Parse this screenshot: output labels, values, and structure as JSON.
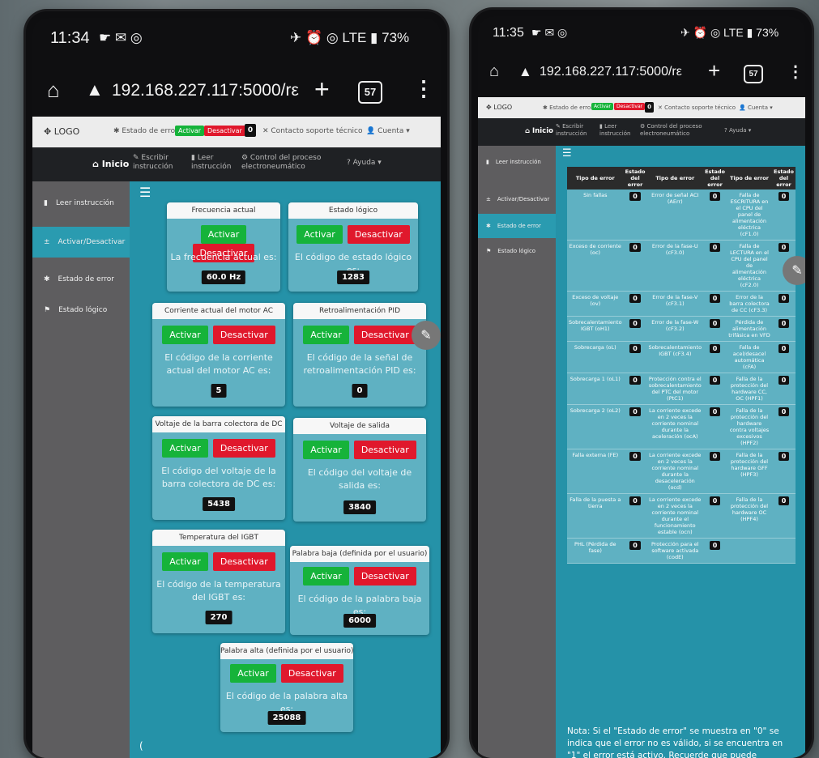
{
  "left_phone": {
    "status": {
      "time": "11:34",
      "icons": "☛ ✉ ◎",
      "right": "✈ ⏰ ◎ LTE ▮ 73%"
    },
    "urlbar": {
      "url": "192.168.227.117:5000/rε",
      "tabs": "57"
    },
    "topbar": {
      "logo": "✥ LOGO",
      "estado_error": "✱ Estado de error",
      "activar": "Activar",
      "desactivar": "Desactivar",
      "error_value": "0",
      "contacto": "✕ Contacto soporte técnico",
      "cuenta": "👤 Cuenta ▾"
    },
    "navbar": {
      "inicio": "⌂ Inicio",
      "escribir": "✎ Escribir instrucción",
      "leer": "▮ Leer instrucción",
      "control": "⚙ Control del proceso electroneumático",
      "ayuda": "? Ayuda ▾"
    },
    "sidebar": [
      {
        "label": "Leer instrucción",
        "icon": "▮"
      },
      {
        "label": "Activar/Desactivar",
        "icon": "±"
      },
      {
        "label": "Estado de error",
        "icon": "✱"
      },
      {
        "label": "Estado lógico",
        "icon": "⚑"
      }
    ],
    "menu_icon": "☰",
    "cards": [
      {
        "title": "Frecuencia actual",
        "activar": "Activar",
        "desactivar": "Desactivar",
        "desc": "La frecuencia actual es:",
        "value": "60.0 Hz"
      },
      {
        "title": "Estado lógico",
        "activar": "Activar",
        "desactivar": "Desactivar",
        "desc": "El código de estado lógico es:",
        "value": "1283"
      },
      {
        "title": "Corriente actual del motor AC",
        "activar": "Activar",
        "desactivar": "Desactivar",
        "desc": "El código de la corriente actual del motor AC es:",
        "value": "5"
      },
      {
        "title": "Retroalimentación PID",
        "activar": "Activar",
        "desactivar": "Desactivar",
        "desc": "El código de la señal de retroalimentación PID es:",
        "value": "0"
      },
      {
        "title": "Voltaje de la barra colectora de DC",
        "activar": "Activar",
        "desactivar": "Desactivar",
        "desc": "El código del voltaje de la barra colectora de DC es:",
        "value": "5438"
      },
      {
        "title": "Voltaje de salida",
        "activar": "Activar",
        "desactivar": "Desactivar",
        "desc": "El código del voltaje de salida es:",
        "value": "3840"
      },
      {
        "title": "Temperatura del IGBT",
        "activar": "Activar",
        "desactivar": "Desactivar",
        "desc": "El código de la temperatura del IGBT es:",
        "value": "270"
      },
      {
        "title": "Palabra baja (definida por el usuario)",
        "activar": "Activar",
        "desactivar": "Desactivar",
        "desc": "El código de la palabra baja es:",
        "value": "6000"
      },
      {
        "title": "Palabra alta (definida por el usuario)",
        "activar": "Activar",
        "desactivar": "Desactivar",
        "desc": "El código de la palabra alta es:",
        "value": "25088"
      }
    ],
    "footer_char": "("
  },
  "right_phone": {
    "status": {
      "time": "11:35",
      "icons": "☛ ✉ ◎",
      "right": "✈ ⏰ ◎ LTE ▮ 73%"
    },
    "urlbar": {
      "url": "192.168.227.117:5000/rε",
      "tabs": "57"
    },
    "topbar": {
      "logo": "✥ LOGO",
      "estado_error": "✱ Estado de error",
      "activar": "Activar",
      "desactivar": "Desactivar",
      "error_value": "0",
      "contacto": "✕ Contacto soporte técnico",
      "cuenta": "👤 Cuenta ▾"
    },
    "navbar": {
      "inicio": "⌂ Inicio",
      "escribir": "✎ Escribir instrucción",
      "leer": "▮ Leer instrucción",
      "control": "⚙ Control del proceso electroneumático",
      "ayuda": "? Ayuda ▾"
    },
    "sidebar": [
      {
        "label": "Leer instrucción",
        "icon": "▮"
      },
      {
        "label": "Activar/Desactivar",
        "icon": "±"
      },
      {
        "label": "Estado de error",
        "icon": "✱"
      },
      {
        "label": "Estado lógico",
        "icon": "⚑"
      }
    ],
    "menu_icon": "☰",
    "table": {
      "headers": [
        "Tipo de error",
        "Estado del error",
        "Tipo de error",
        "Estado del error",
        "Tipo de error",
        "Estado del error"
      ],
      "rows": [
        [
          "Sin fallas",
          "0",
          "Error de señal ACI (AErr)",
          "0",
          "Falla de ESCRITURA en el CPU del panel de alimentación eléctrica (cF1.0)",
          "0"
        ],
        [
          "Exceso de corriente (oc)",
          "0",
          "Error de la fase-U (cF3.0)",
          "0",
          "Falla de LECTURA en el CPU del panel de alimentación eléctrica (cF2.0)",
          "0"
        ],
        [
          "Exceso de voltaje (ov)",
          "0",
          "Error de la fase-V (cF3.1)",
          "0",
          "Error de la barra colectora de CC (cF3.3)",
          "0"
        ],
        [
          "Sobrecalentamiento IGBT (oH1)",
          "0",
          "Error de la fase-W (cF3.2)",
          "0",
          "Pérdida de alimentación trifásica en VFD",
          "0"
        ],
        [
          "Sobrecarga (oL)",
          "0",
          "Sobrecalentamiento IGBT (cF3.4)",
          "0",
          "Falla de acel/desacel automática (cFA)",
          "0"
        ],
        [
          "Sobrecarga 1 (oL1)",
          "0",
          "Protección contra el sobrecalentamiento del PTC del motor (PtC1)",
          "0",
          "Falla de la protección del hardware CC, OC (HPF1)",
          "0"
        ],
        [
          "Sobrecarga 2 (oL2)",
          "0",
          "La corriente excede en 2 veces la corriente nominal durante la aceleración (ocA)",
          "0",
          "Falla de la protección del hardware contra voltajes excesivos (HPF2)",
          "0"
        ],
        [
          "Falla externa (FE)",
          "0",
          "La corriente excede en 2 veces la corriente nominal durante la desaceleración (ocd)",
          "0",
          "Falla de la protección del hardware GFF (HPF3)",
          "0"
        ],
        [
          "Falla de la puesta a tierra",
          "0",
          "La corriente excede en 2 veces la corriente nominal durante el funcionamiento estable (ocn)",
          "0",
          "Falla de la protección del hardware OC (HPF4)",
          "0"
        ],
        [
          "PHL (Pérdida de fase)",
          "0",
          "Protección para el software activada (codE)",
          "0",
          "",
          ""
        ]
      ]
    },
    "note": "Nota: Si el \"Estado de error\" se muestra en \"0\" se indica que el error no es válido, si se encuentra en \"1\" el error está activo. Recuerde que puede consultar la sección de"
  }
}
